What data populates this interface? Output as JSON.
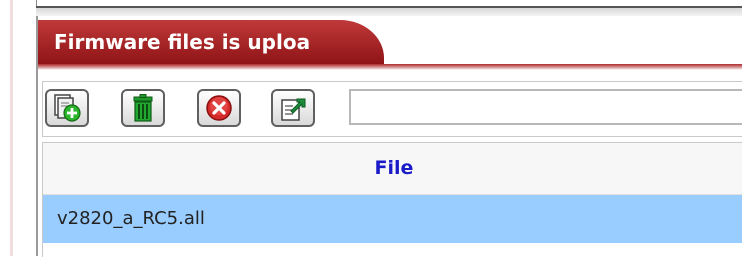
{
  "panel": {
    "title": "Firmware files is uploa"
  },
  "toolbar": {
    "buttons": [
      {
        "name": "add-file",
        "icon": "add-file-icon"
      },
      {
        "name": "delete",
        "icon": "trash-icon"
      },
      {
        "name": "cancel",
        "icon": "cancel-icon"
      },
      {
        "name": "upload",
        "icon": "upload-icon"
      }
    ],
    "path_value": ""
  },
  "file_table": {
    "columns": [
      "File"
    ],
    "rows": [
      {
        "file": "v2820_a_RC5.all",
        "selected": true
      }
    ]
  },
  "colors": {
    "title_bar": "#a9292b",
    "header_text": "#1a1ac8",
    "selected_row": "#99ccff",
    "add_icon_green": "#2bb52b",
    "delete_icon_green": "#1f9a2a",
    "cancel_icon_red": "#d42a2a",
    "upload_icon_green": "#1e8f3a"
  }
}
